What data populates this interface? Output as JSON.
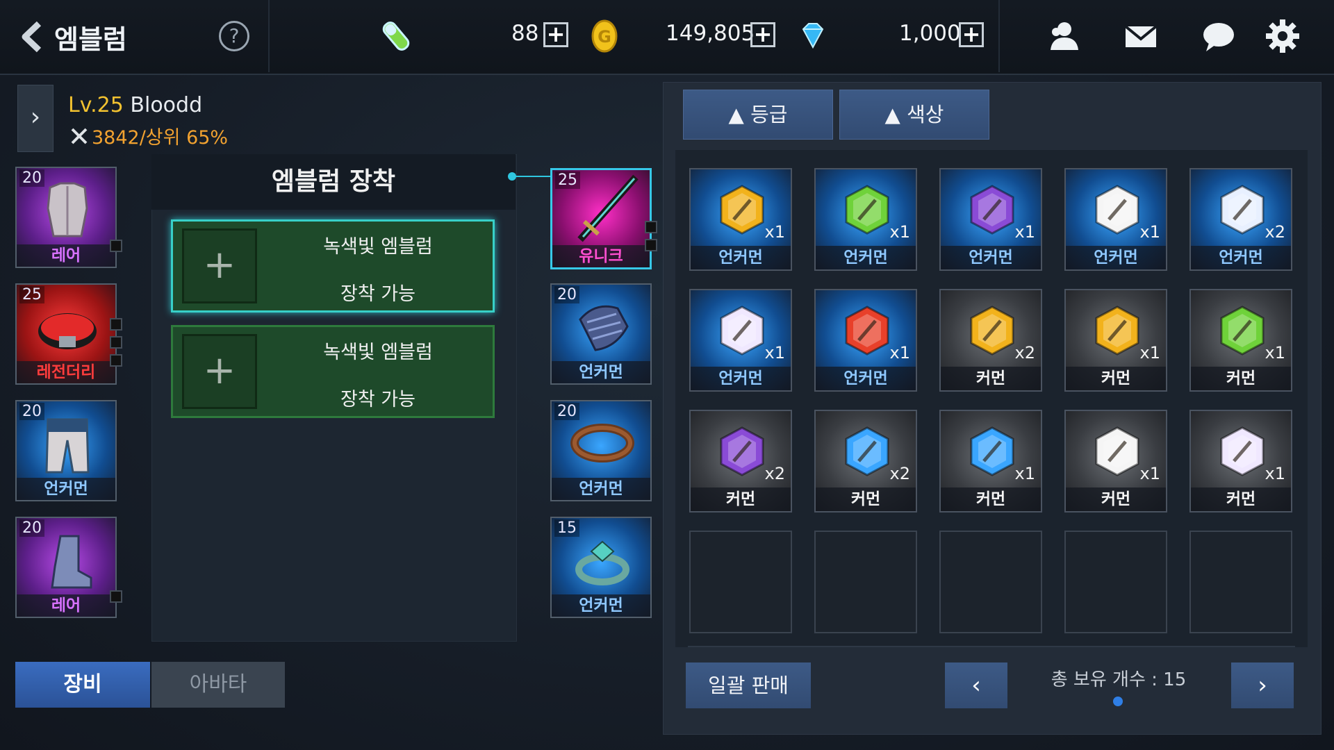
{
  "header": {
    "title": "엠블럼",
    "back_icon": "back-arrow-icon",
    "help_label": "?",
    "currency": [
      {
        "icon": "energy-icon",
        "value": "88"
      },
      {
        "icon": "gold-coin-icon",
        "value": "149,805"
      },
      {
        "icon": "diamond-icon",
        "value": "1,000"
      }
    ],
    "plus_label": "+",
    "right_icons": [
      "friends-icon",
      "mail-icon",
      "chat-icon",
      "settings-icon"
    ]
  },
  "character": {
    "level": "Lv.25",
    "name": "Bloodd",
    "power": "3842/상위 65%",
    "expand_label": "›"
  },
  "left_slots": [
    {
      "level": "20",
      "rarity": "레어",
      "item": "armor"
    },
    {
      "level": "25",
      "rarity": "레전더리",
      "item": "belt"
    },
    {
      "level": "20",
      "rarity": "언커먼",
      "item": "pants"
    },
    {
      "level": "20",
      "rarity": "레어",
      "item": "boots"
    }
  ],
  "right_slots": [
    {
      "level": "25",
      "rarity": "유니크",
      "item": "sword"
    },
    {
      "level": "20",
      "rarity": "언커먼",
      "item": "gauntlet"
    },
    {
      "level": "20",
      "rarity": "언커먼",
      "item": "necklace"
    },
    {
      "level": "15",
      "rarity": "언커먼",
      "item": "ring"
    }
  ],
  "emblem_panel": {
    "title": "엠블럼 장착",
    "slots": [
      {
        "plus": "+",
        "line1": "녹색빛 엠블럼",
        "line2": "장착 가능"
      },
      {
        "plus": "+",
        "line1": "녹색빛 엠블럼",
        "line2": "장착 가능"
      }
    ]
  },
  "bottom_tabs": {
    "equip": "장비",
    "avatar": "아바타"
  },
  "inventory": {
    "sort_buttons": [
      "▲ 등급",
      "▲ 색상"
    ],
    "items": [
      {
        "rarity": "언커먼",
        "qty": "x1",
        "icon": "sword-emblem-icon",
        "color": "#f2b21c"
      },
      {
        "rarity": "언커먼",
        "qty": "x1",
        "icon": "eye-emblem-icon",
        "color": "#6fd23a"
      },
      {
        "rarity": "언커먼",
        "qty": "x1",
        "icon": "party-emblem-icon",
        "color": "#8a4bd6"
      },
      {
        "rarity": "언커먼",
        "qty": "x1",
        "icon": "flame-sword-emblem-icon",
        "color": "#f5f5f5"
      },
      {
        "rarity": "언커먼",
        "qty": "x2",
        "icon": "ice-sword-emblem-icon",
        "color": "#e8f0ff"
      },
      {
        "rarity": "언커먼",
        "qty": "x1",
        "icon": "female-sword-emblem-icon",
        "color": "#f0e8ff"
      },
      {
        "rarity": "언커먼",
        "qty": "x1",
        "icon": "shield-emblem-icon",
        "color": "#e8402a"
      },
      {
        "rarity": "커먼",
        "qty": "x2",
        "icon": "sword-emblem-icon",
        "color": "#f2b21c"
      },
      {
        "rarity": "커먼",
        "qty": "x1",
        "icon": "swirl-emblem-icon",
        "color": "#f2b21c"
      },
      {
        "rarity": "커먼",
        "qty": "x1",
        "icon": "eye-emblem-icon",
        "color": "#6fd23a"
      },
      {
        "rarity": "커먼",
        "qty": "x2",
        "icon": "shield-emblem-icon",
        "color": "#8a4bd6"
      },
      {
        "rarity": "커먼",
        "qty": "x2",
        "icon": "target-emblem-icon",
        "color": "#3aa6ff"
      },
      {
        "rarity": "커먼",
        "qty": "x1",
        "icon": "key-emblem-icon",
        "color": "#3aa6ff"
      },
      {
        "rarity": "커먼",
        "qty": "x1",
        "icon": "flame-sword-emblem-icon",
        "color": "#f5f5f5"
      },
      {
        "rarity": "커먼",
        "qty": "x1",
        "icon": "female-sword-emblem-icon",
        "color": "#f0e8ff"
      }
    ],
    "empty_slots": 5,
    "sell_all": "일괄 판매",
    "prev": "‹",
    "next": "›",
    "total": "총 보유 개수 : 15"
  }
}
